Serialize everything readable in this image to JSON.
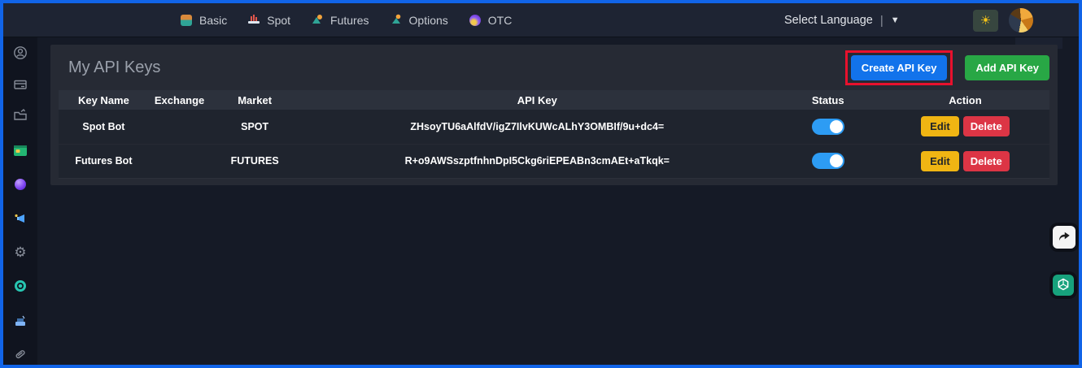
{
  "topbar": {
    "nav": [
      {
        "label": "Basic",
        "icon": "basic-icon"
      },
      {
        "label": "Spot",
        "icon": "spot-icon"
      },
      {
        "label": "Futures",
        "icon": "futures-icon"
      },
      {
        "label": "Options",
        "icon": "options-icon"
      },
      {
        "label": "OTC",
        "icon": "otc-icon"
      }
    ],
    "language_label": "Select Language",
    "language_separator": "|",
    "language_caret": "▼",
    "theme_icon": "sun-icon",
    "avatar_icon": "phoenix-avatar"
  },
  "page": {
    "title": "My API Keys"
  },
  "toolbar": {
    "create_label": "Create API Key",
    "add_label": "Add API Key"
  },
  "table": {
    "headers": [
      "Key Name",
      "Exchange",
      "Market",
      "API Key",
      "Status",
      "Action"
    ],
    "action_labels": {
      "edit": "Edit",
      "delete": "Delete"
    },
    "rows": [
      {
        "key_name": "Spot Bot",
        "exchange": "",
        "market": "SPOT",
        "api_key": "ZHsoyTU6aAlfdV/igZ7IlvKUWcALhY3OMBIf/9u+dc4=",
        "status": "on"
      },
      {
        "key_name": "Futures Bot",
        "exchange": "",
        "market": "FUTURES",
        "api_key": "R+o9AWSszptfnhnDpI5Ckg6riEPEABn3cmAEt+aTkqk=",
        "status": "on"
      }
    ]
  },
  "sidebar": {
    "icons": [
      "user-circle-icon",
      "credit-card-icon",
      "folder-share-icon",
      "wallet-icon",
      "sphere-icon",
      "megaphone-icon",
      "gear-icon",
      "disc-icon",
      "report-device-icon",
      "paperclip-icon"
    ]
  },
  "floating": {
    "share_icon": "share-arrow-icon",
    "assistant_icon": "chatgpt-icon"
  },
  "colors": {
    "frame_border_blue": "#1164e8",
    "topbar_bg": "#1e2433",
    "sidebar_bg": "#10141f",
    "panel_bg": "#262a34",
    "row_bg": "#1f242e",
    "primary_blue": "#1273eb",
    "success_green": "#28a745",
    "warning_yellow": "#f0b513",
    "danger_red": "#dc3545",
    "toggle_blue": "#2d9cf4",
    "annotation_red": "#e8112d",
    "assistant_green": "#17a27c"
  }
}
